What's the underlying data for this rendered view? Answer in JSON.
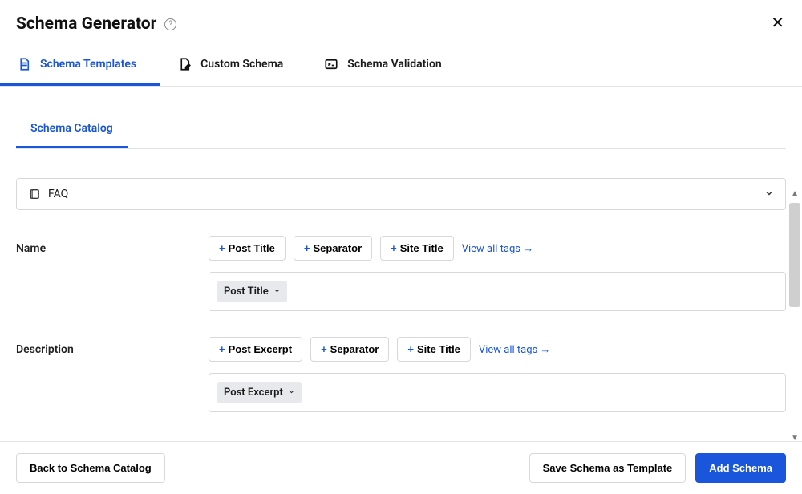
{
  "title": "Schema Generator",
  "close_label": "✕",
  "main_tabs": [
    {
      "label": "Schema Templates"
    },
    {
      "label": "Custom Schema"
    },
    {
      "label": "Schema Validation"
    }
  ],
  "sub_tab": "Schema Catalog",
  "schema_select": {
    "value": "FAQ"
  },
  "fields": [
    {
      "label": "Name",
      "tags": [
        "Post Title",
        "Separator",
        "Site Title"
      ],
      "view_all": "View all tags →",
      "chip": "Post Title"
    },
    {
      "label": "Description",
      "tags": [
        "Post Excerpt",
        "Separator",
        "Site Title"
      ],
      "view_all": "View all tags →",
      "chip": "Post Excerpt"
    }
  ],
  "footer": {
    "back": "Back to Schema Catalog",
    "save_template": "Save Schema as Template",
    "add": "Add Schema"
  }
}
